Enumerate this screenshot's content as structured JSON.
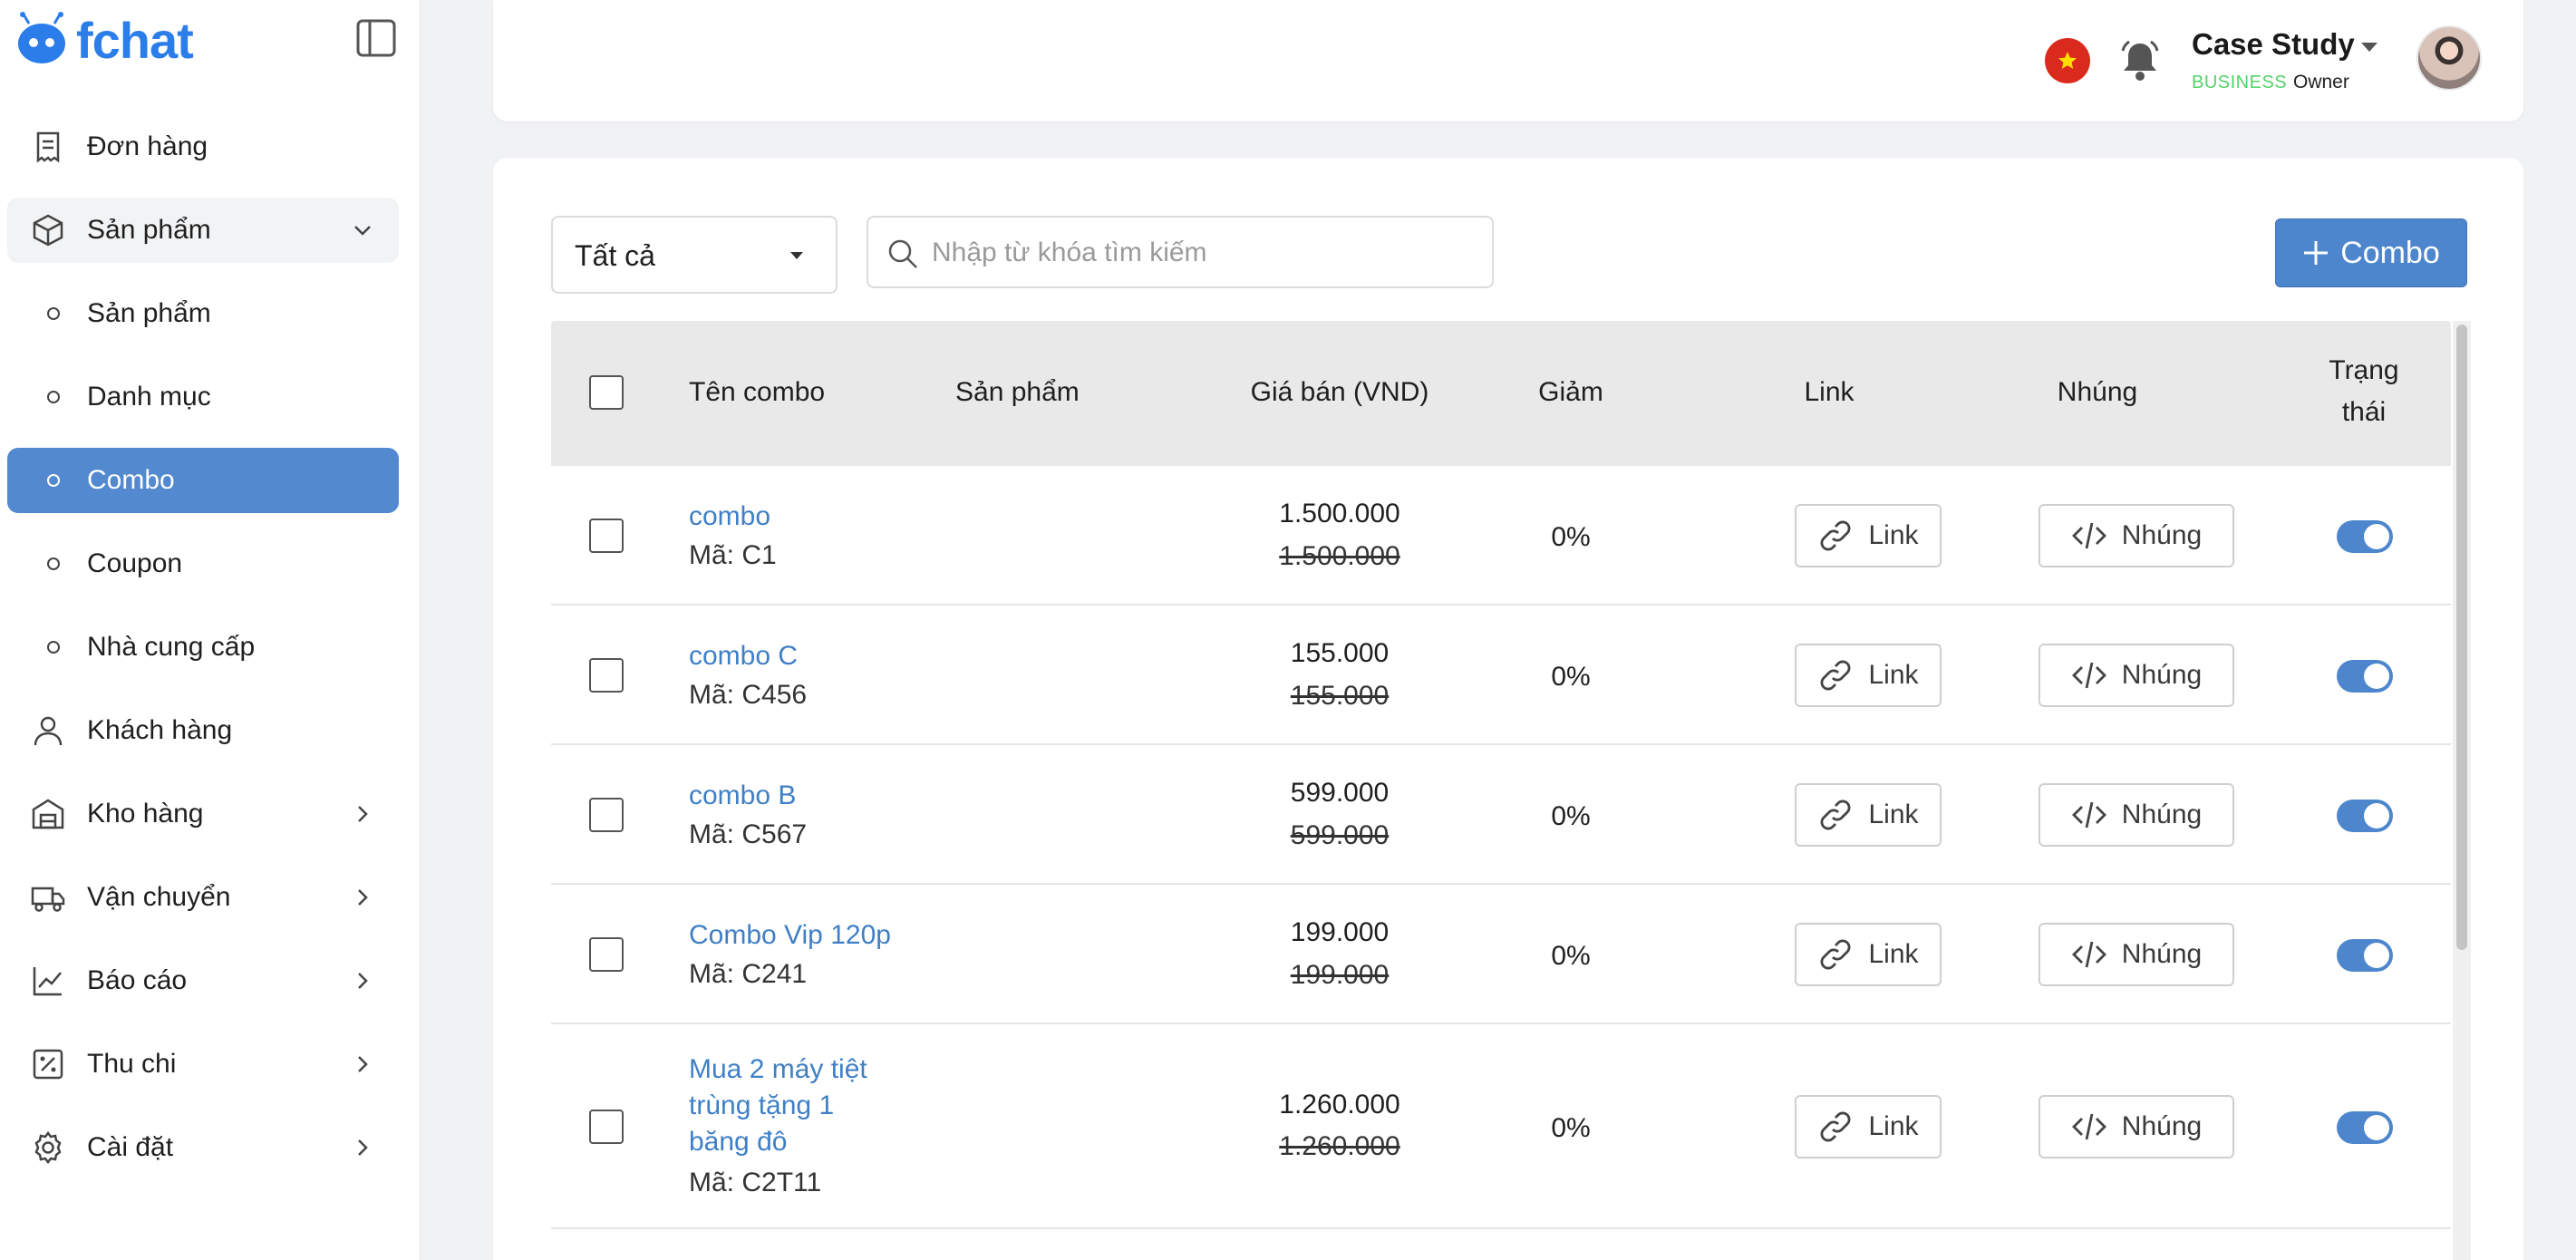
{
  "brand": {
    "name": "fchat",
    "color": "#2b7de9"
  },
  "sidebar": {
    "items": [
      {
        "label": "Đơn hàng",
        "icon": "receipt-icon"
      },
      {
        "label": "Sản phẩm",
        "icon": "box-icon",
        "expanded": true
      },
      {
        "label": "Sản phẩm",
        "sub": true
      },
      {
        "label": "Danh mục",
        "sub": true
      },
      {
        "label": "Combo",
        "sub": true,
        "active": true
      },
      {
        "label": "Coupon",
        "sub": true
      },
      {
        "label": "Nhà cung cấp",
        "sub": true
      },
      {
        "label": "Khách hàng",
        "icon": "user-icon"
      },
      {
        "label": "Kho hàng",
        "icon": "warehouse-icon"
      },
      {
        "label": "Vận chuyển",
        "icon": "truck-icon"
      },
      {
        "label": "Báo cáo",
        "icon": "chart-line-icon"
      },
      {
        "label": "Thu chi",
        "icon": "percent-icon"
      },
      {
        "label": "Cài đặt",
        "icon": "gear-icon"
      }
    ]
  },
  "header": {
    "account_name": "Case Study",
    "plan": "BUSINESS",
    "role": "Owner"
  },
  "toolbar": {
    "filter_value": "Tất cả",
    "search_placeholder": "Nhập từ khóa tìm kiếm",
    "add_label": "Combo"
  },
  "table": {
    "headers": {
      "name": "Tên combo",
      "product": "Sản phẩm",
      "price": "Giá bán (VND)",
      "discount": "Giảm",
      "link": "Link",
      "embed": "Nhúng",
      "status_line1": "Trạng",
      "status_line2": "thái"
    },
    "link_label": "Link",
    "embed_label": "Nhúng",
    "rows": [
      {
        "name": "combo",
        "code": "Mã: C1",
        "price": "1.500.000",
        "old_price": "1.500.000",
        "discount": "0%",
        "enabled": true
      },
      {
        "name": "combo C",
        "code": "Mã: C456",
        "price": "155.000",
        "old_price": "155.000",
        "discount": "0%",
        "enabled": true
      },
      {
        "name": "combo B",
        "code": "Mã: C567",
        "price": "599.000",
        "old_price": "599.000",
        "discount": "0%",
        "enabled": true
      },
      {
        "name": "Combo Vip 120p",
        "code": "Mã: C241",
        "price": "199.000",
        "old_price": "199.000",
        "discount": "0%",
        "enabled": true
      },
      {
        "name": "Mua 2 máy tiệt trùng tặng 1 băng đô",
        "code": "Mã: C2T11",
        "price": "1.260.000",
        "old_price": "1.260.000",
        "discount": "0%",
        "enabled": true
      }
    ]
  },
  "colors": {
    "accent": "#4d86cc",
    "link_text": "#3f7fc6",
    "active_nav": "#5289cf",
    "plan_badge": "#55d36a"
  }
}
